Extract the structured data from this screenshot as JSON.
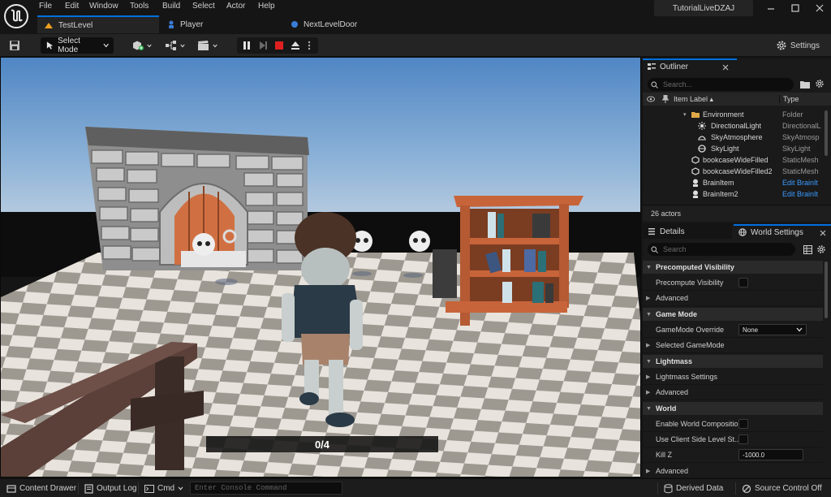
{
  "menu": {
    "items": [
      "File",
      "Edit",
      "Window",
      "Tools",
      "Build",
      "Select",
      "Actor",
      "Help"
    ]
  },
  "tabs": [
    {
      "label": "TestLevel",
      "icon": "level-icon",
      "active": true
    },
    {
      "label": "Player",
      "icon": "blueprint-icon",
      "active": false
    },
    {
      "label": "NextLevelDoor",
      "icon": "blueprint-icon",
      "active": false
    }
  ],
  "project_name": "TutorialLiveDZAJ",
  "toolbar": {
    "select_mode_label": "Select Mode",
    "settings_label": "Settings"
  },
  "viewport": {
    "counter_text": "0/4"
  },
  "outliner": {
    "tab_label": "Outliner",
    "search_placeholder": "Search...",
    "col_label": "Item Label ▴",
    "col_type": "Type",
    "rows": [
      {
        "name": "Environment",
        "type": "Folder",
        "icon": "folder-icon",
        "indent": 2,
        "link": false
      },
      {
        "name": "DirectionalLight",
        "type": "DirectionalL",
        "icon": "sun-light-icon",
        "indent": 3,
        "link": false
      },
      {
        "name": "SkyAtmosphere",
        "type": "SkyAtmosp",
        "icon": "sky-atmosphere-icon",
        "indent": 3,
        "link": false
      },
      {
        "name": "SkyLight",
        "type": "SkyLight",
        "icon": "sky-light-icon",
        "indent": 3,
        "link": false
      },
      {
        "name": "bookcaseWideFilled",
        "type": "StaticMesh",
        "icon": "static-mesh-icon",
        "indent": 1,
        "link": false
      },
      {
        "name": "bookcaseWideFilled2",
        "type": "StaticMesh",
        "icon": "static-mesh-icon",
        "indent": 1,
        "link": false
      },
      {
        "name": "BrainItem",
        "type": "Edit BrainIt",
        "icon": "actor-icon",
        "indent": 1,
        "link": true
      },
      {
        "name": "BrainItem2",
        "type": "Edit BrainIt",
        "icon": "actor-icon",
        "indent": 1,
        "link": true
      }
    ],
    "actor_count": "26 actors"
  },
  "details": {
    "tab_details": "Details",
    "tab_world_settings": "World Settings",
    "search_placeholder": "Search",
    "rows": [
      {
        "kind": "category",
        "label": "Precomputed Visibility"
      },
      {
        "kind": "prop",
        "label": "Precompute Visibility",
        "control": "checkbox"
      },
      {
        "kind": "sub",
        "label": "Advanced"
      },
      {
        "kind": "category",
        "label": "Game Mode"
      },
      {
        "kind": "prop",
        "label": "GameMode Override",
        "control": "dropdown",
        "value": "None"
      },
      {
        "kind": "sub",
        "label": "Selected GameMode"
      },
      {
        "kind": "category",
        "label": "Lightmass"
      },
      {
        "kind": "sub",
        "label": "Lightmass Settings"
      },
      {
        "kind": "sub",
        "label": "Advanced"
      },
      {
        "kind": "category",
        "label": "World"
      },
      {
        "kind": "prop",
        "label": "Enable World Composition",
        "control": "checkbox"
      },
      {
        "kind": "prop",
        "label": "Use Client Side Level St...",
        "control": "checkbox"
      },
      {
        "kind": "prop",
        "label": "Kill Z",
        "control": "number",
        "value": "-1000.0"
      },
      {
        "kind": "sub",
        "label": "Advanced"
      }
    ]
  },
  "statusbar": {
    "content_drawer": "Content Drawer",
    "output_log": "Output Log",
    "cmd_label": "Cmd",
    "console_placeholder": "Enter Console Command",
    "derived_data": "Derived Data",
    "source_control": "Source Control Off"
  },
  "colors": {
    "accent_blue": "#0070e0",
    "link_blue": "#3a9bff",
    "stop_red": "#e02020",
    "panel_bg": "#1a1a1a",
    "toolbar_bg": "#242424"
  }
}
